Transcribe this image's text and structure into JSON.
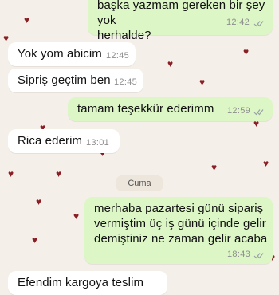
{
  "messages": [
    {
      "dir": "out",
      "text_lines": [
        "başka yazmam gereken bir şey yok",
        "herhalde?"
      ],
      "time": "12:42"
    },
    {
      "dir": "in",
      "text_lines": [
        "Yok yom abicim"
      ],
      "time": "12:45"
    },
    {
      "dir": "in",
      "text_lines": [
        "Sipriş geçtim ben"
      ],
      "time": "12:45"
    },
    {
      "dir": "out",
      "text_lines": [
        "tamam teşekkür ederimm"
      ],
      "time": "12:59"
    },
    {
      "dir": "in",
      "text_lines": [
        "Rica ederim"
      ],
      "time": "13:01"
    },
    {
      "dir": "out",
      "text_lines": [
        "merhaba pazartesi günü sipariş",
        "vermiştim üç iş günü içinde gelir",
        "demiştiniz ne zaman gelir acaba"
      ],
      "time": "18:43"
    },
    {
      "dir": "in",
      "text_lines": [
        "Efendim kargoya teslim"
      ],
      "time": ""
    }
  ],
  "day_divider": {
    "label": "Cuma"
  },
  "colors": {
    "outgoing_bubble": "#dcf6c6",
    "incoming_bubble": "#ffffff",
    "wallpaper": "#f4efe8",
    "heart": "#8a1e24",
    "tick": "#9aa3a8"
  },
  "icons": {
    "wallpaper_pattern": "heart-icon",
    "read_receipt": "double-check-icon"
  }
}
